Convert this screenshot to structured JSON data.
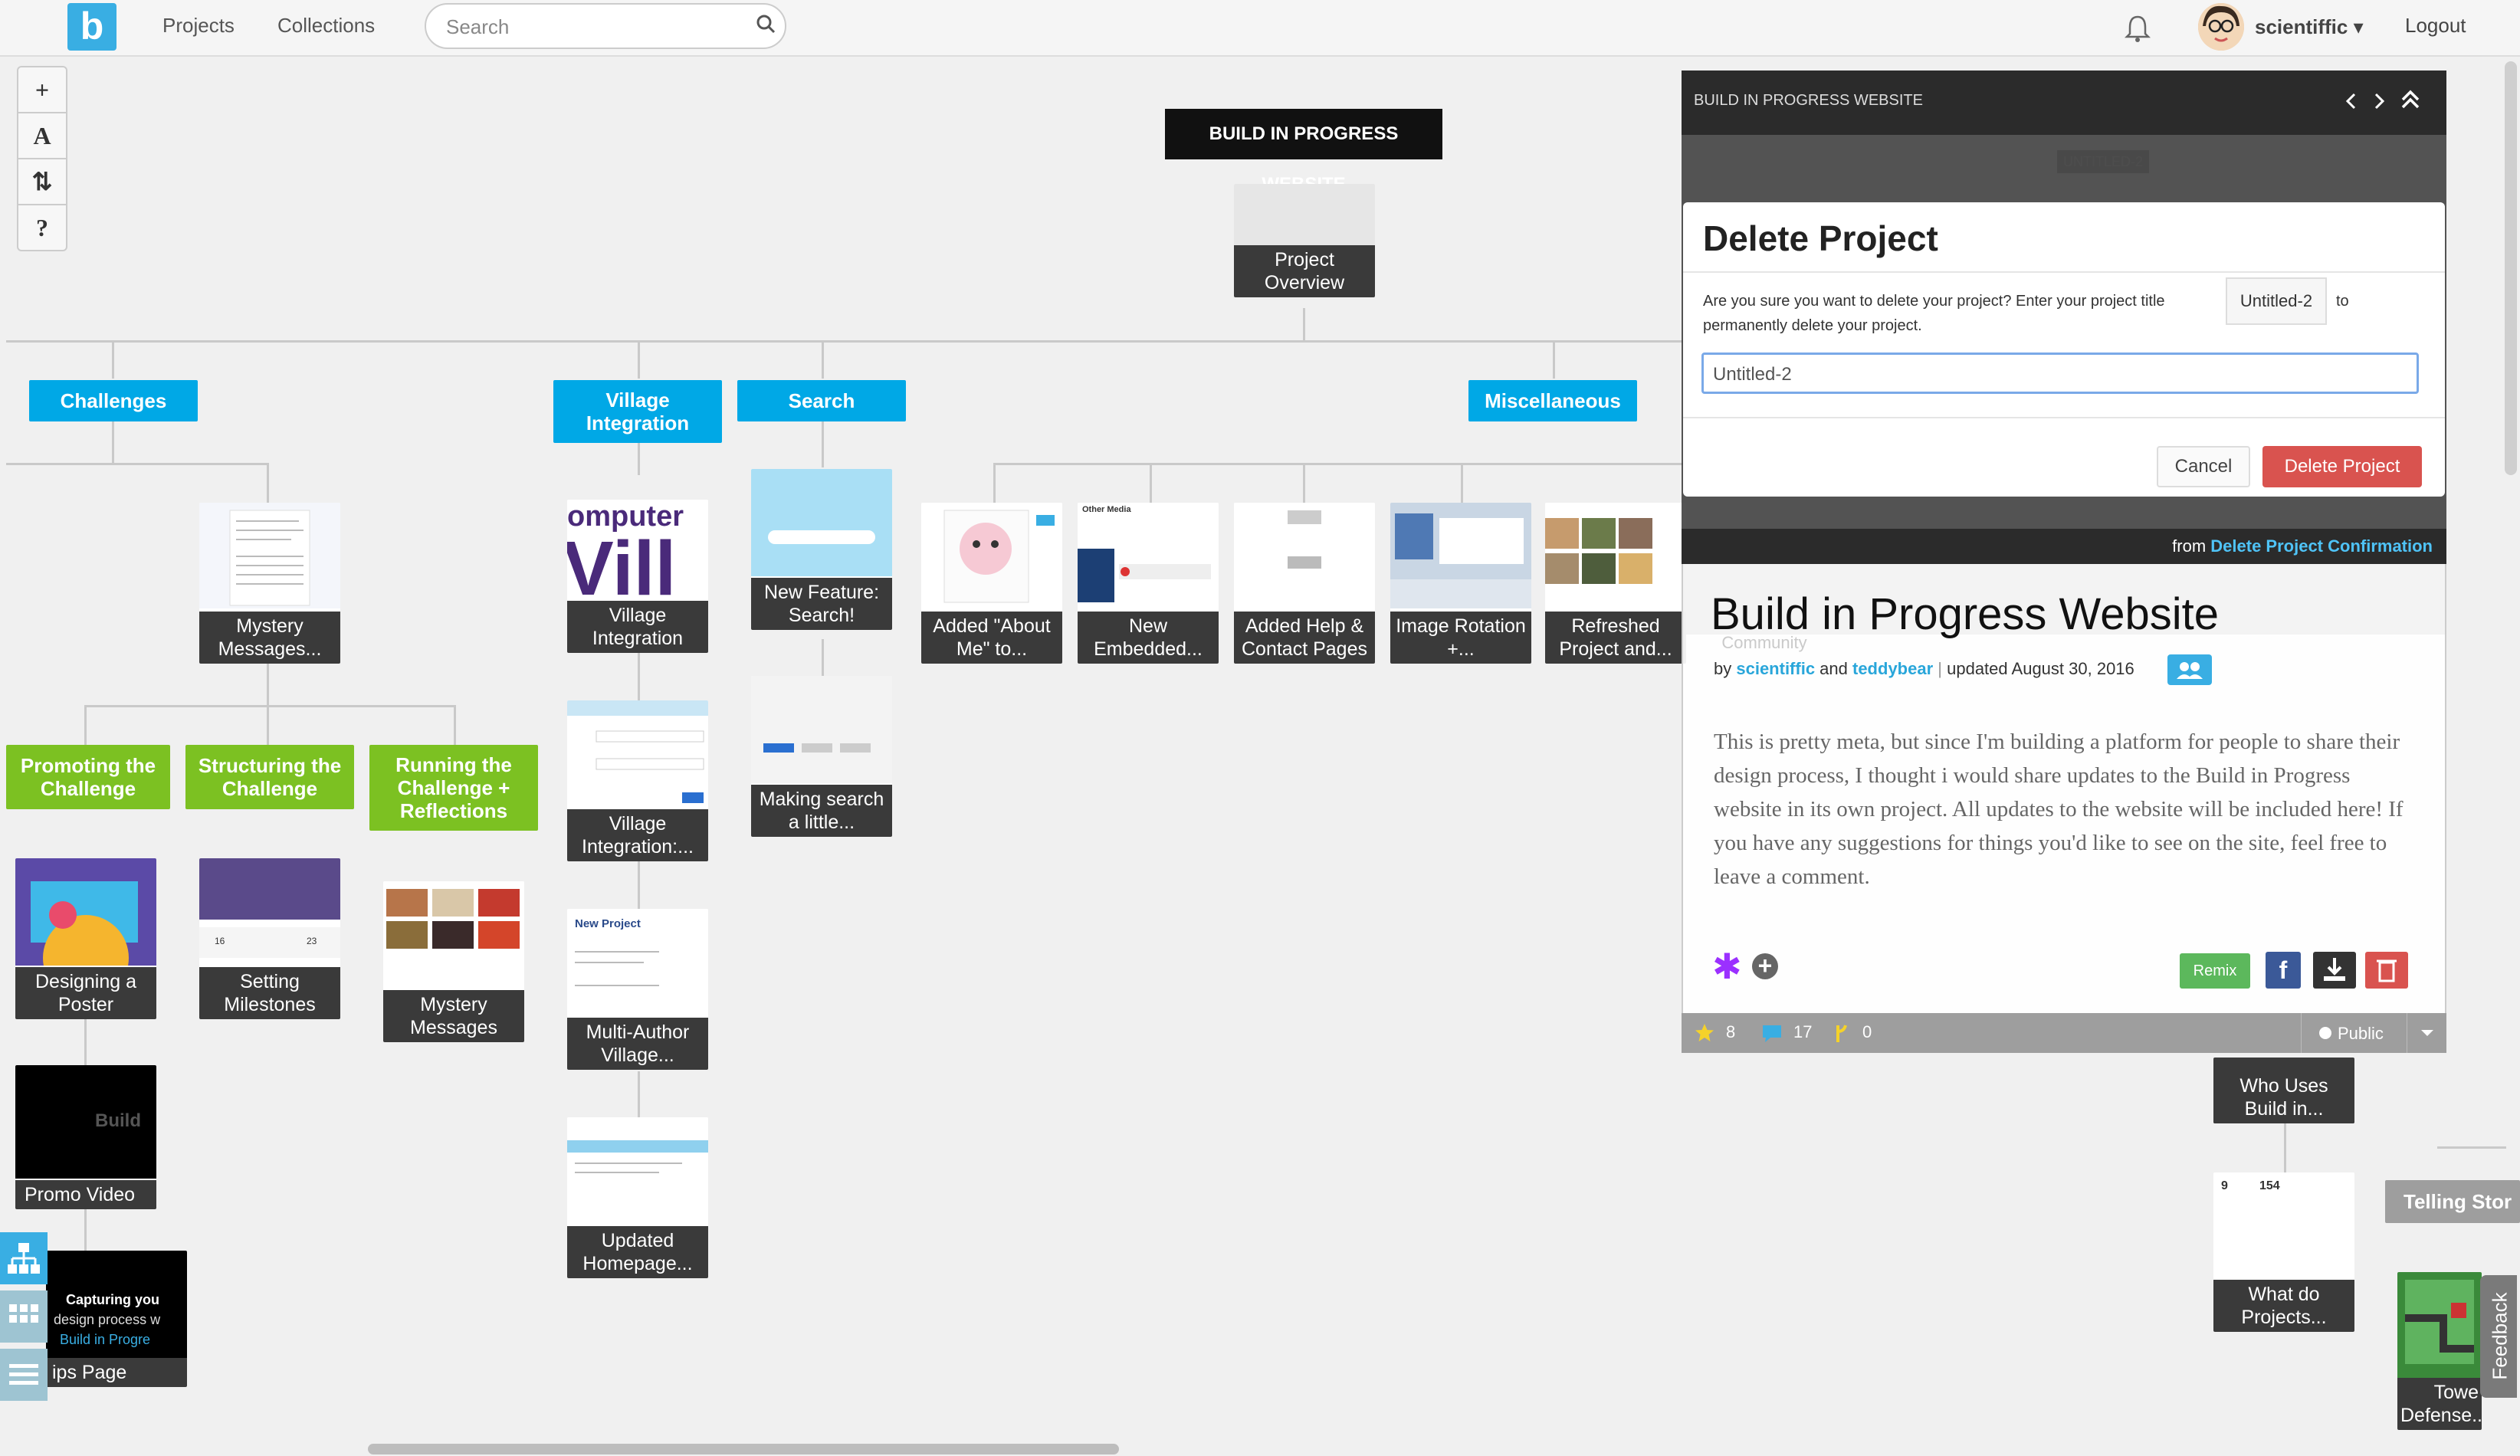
{
  "nav": {
    "logo": "b",
    "projects": "Projects",
    "collections": "Collections",
    "search_placeholder": "Search",
    "username": "scientiffic ▾",
    "logout": "Logout"
  },
  "tools": {
    "zoom_in": "+",
    "text": "A",
    "sort": "⇅",
    "help": "?"
  },
  "tree": {
    "root_title": "BUILD IN PROGRESS WEBSITE",
    "root_card": "Project Overview",
    "categories": [
      {
        "label": "Challenges"
      },
      {
        "label": "Village Integration"
      },
      {
        "label": "Search"
      },
      {
        "label": "Miscellaneous"
      },
      {
        "label": "Promoting the Challenge"
      },
      {
        "label": "Structuring the Challenge"
      },
      {
        "label": "Running the Challenge + Reflections"
      },
      {
        "label": "Telling Stor"
      }
    ],
    "cards": [
      {
        "label": "Mystery Messages..."
      },
      {
        "label": "Village Integration"
      },
      {
        "label": "New Feature: Search!"
      },
      {
        "label": "Added \"About Me\" to..."
      },
      {
        "label": "New Embedded..."
      },
      {
        "label": "Added Help & Contact Pages"
      },
      {
        "label": "Image Rotation +..."
      },
      {
        "label": "Refreshed Project and..."
      },
      {
        "label": "Village Integration:..."
      },
      {
        "label": "Making search a little..."
      },
      {
        "label": "Designing a Poster"
      },
      {
        "label": "Setting Milestones"
      },
      {
        "label": "Mystery Messages"
      },
      {
        "label": "Multi-Author Village..."
      },
      {
        "label": "Promo Video"
      },
      {
        "label": "Updated Homepage..."
      },
      {
        "label": "ips Page"
      },
      {
        "label": "Who Uses Build in..."
      },
      {
        "label": "What do Projects..."
      },
      {
        "label": "Towe Defense..."
      }
    ]
  },
  "panel": {
    "header": "BUILD IN PROGRESS WEBSITE",
    "modal_title": "Delete Project",
    "modal_msg1": "Are you sure you want to delete your project? Enter your project title",
    "modal_chip": "Untitled-2",
    "modal_to": "to",
    "modal_msg2": "permanently delete your project.",
    "modal_input": "Untitled-2",
    "cancel": "Cancel",
    "delete": "Delete Project",
    "from_prefix": "from ",
    "from_link": "Delete Project Confirmation",
    "title": "Build in Progress Website",
    "by": "by ",
    "author1": "scientiffic",
    "and": " and ",
    "author2": "teddybear",
    "sep": " | ",
    "updated": "updated August 30, 2016",
    "description": "This is pretty meta, but since I'm building a platform for people to share their design process, I thought i would share updates to the Build in Progress website in its own project. All updates to the website will be included here! If you have any suggestions for things you'd like to see on the site, feel free to leave a comment.",
    "remix": "Remix",
    "stats": {
      "favorites": "8",
      "comments": "17",
      "remixes": "0"
    },
    "privacy": "Public"
  },
  "feedback": "Feedback",
  "colors": {
    "accent": "#00a8e6",
    "green": "#7cc122",
    "danger": "#d9534f"
  }
}
